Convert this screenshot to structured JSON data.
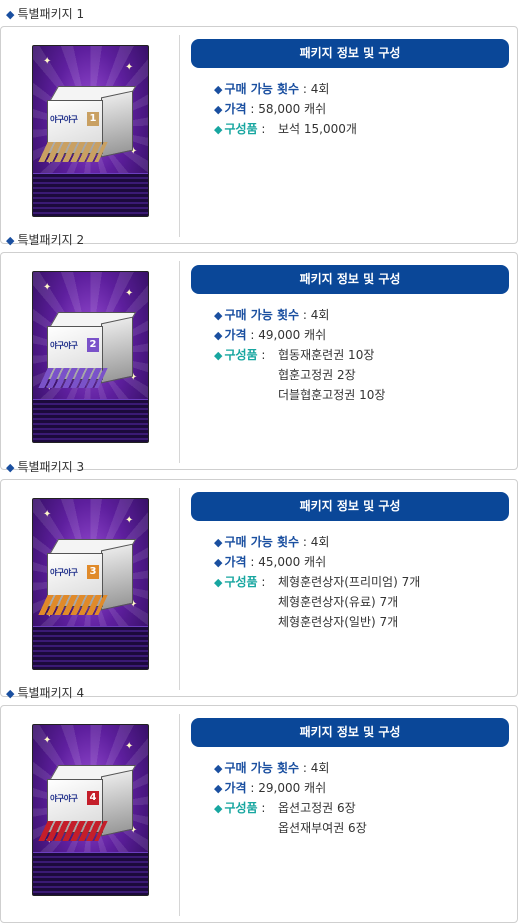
{
  "header_label": "패키지 정보 및 구성",
  "packages": [
    {
      "title": "특별패키지 1",
      "number": "1",
      "count_label": "구매 가능 횟수",
      "count_value": " : 4회",
      "price_label": "가격",
      "price_value": " : 58,000 캐쉬",
      "items_label": "구성품",
      "items": [
        "보석 15,000개"
      ],
      "box_color": "#c9a062"
    },
    {
      "title": "특별패키지 2",
      "number": "2",
      "count_label": "구매 가능 횟수",
      "count_value": " : 4회",
      "price_label": "가격",
      "price_value": " : 49,000 캐쉬",
      "items_label": "구성품",
      "items": [
        "협동재훈련권 10장",
        "협훈고정권 2장",
        "더블협훈고정권 10장"
      ],
      "box_color": "#7a52c9"
    },
    {
      "title": "특별패키지 3",
      "number": "3",
      "count_label": "구매 가능 횟수",
      "count_value": " : 4회",
      "price_label": "가격",
      "price_value": " : 45,000 캐쉬",
      "items_label": "구성품",
      "items": [
        "체형훈련상자(프리미엄) 7개",
        "체형훈련상자(유료) 7개",
        "체형훈련상자(일반) 7개"
      ],
      "box_color": "#e08a2a"
    },
    {
      "title": "특별패키지 4",
      "number": "4",
      "count_label": "구매 가능 횟수",
      "count_value": " : 4회",
      "price_label": "가격",
      "price_value": " : 29,000 캐쉬",
      "items_label": "구성품",
      "items": [
        "옵션고정권 6장",
        "옵션재부여권 6장"
      ],
      "box_color": "#c41e2a"
    }
  ],
  "thumb_logo": "야구야구",
  "colors": {
    "header_bg": "#0a4798",
    "label_blue": "#1a4fa0",
    "label_teal": "#17a6a0"
  },
  "icons": {
    "bullet": "diamond-bullet-icon",
    "sparkle": "sparkle-icon"
  }
}
